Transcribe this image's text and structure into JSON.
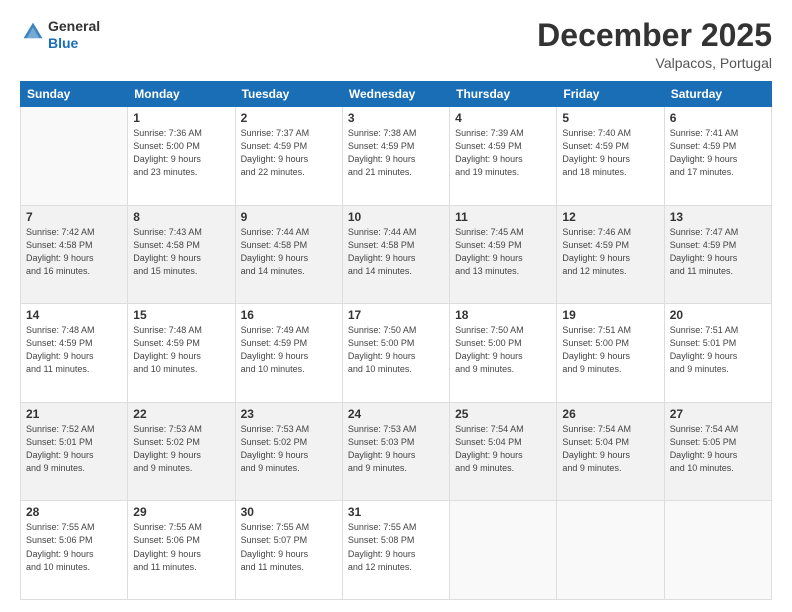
{
  "header": {
    "logo_line1": "General",
    "logo_line2": "Blue",
    "month": "December 2025",
    "location": "Valpacos, Portugal"
  },
  "weekdays": [
    "Sunday",
    "Monday",
    "Tuesday",
    "Wednesday",
    "Thursday",
    "Friday",
    "Saturday"
  ],
  "weeks": [
    [
      {
        "day": "",
        "info": ""
      },
      {
        "day": "1",
        "info": "Sunrise: 7:36 AM\nSunset: 5:00 PM\nDaylight: 9 hours\nand 23 minutes."
      },
      {
        "day": "2",
        "info": "Sunrise: 7:37 AM\nSunset: 4:59 PM\nDaylight: 9 hours\nand 22 minutes."
      },
      {
        "day": "3",
        "info": "Sunrise: 7:38 AM\nSunset: 4:59 PM\nDaylight: 9 hours\nand 21 minutes."
      },
      {
        "day": "4",
        "info": "Sunrise: 7:39 AM\nSunset: 4:59 PM\nDaylight: 9 hours\nand 19 minutes."
      },
      {
        "day": "5",
        "info": "Sunrise: 7:40 AM\nSunset: 4:59 PM\nDaylight: 9 hours\nand 18 minutes."
      },
      {
        "day": "6",
        "info": "Sunrise: 7:41 AM\nSunset: 4:59 PM\nDaylight: 9 hours\nand 17 minutes."
      }
    ],
    [
      {
        "day": "7",
        "info": "Sunrise: 7:42 AM\nSunset: 4:58 PM\nDaylight: 9 hours\nand 16 minutes."
      },
      {
        "day": "8",
        "info": "Sunrise: 7:43 AM\nSunset: 4:58 PM\nDaylight: 9 hours\nand 15 minutes."
      },
      {
        "day": "9",
        "info": "Sunrise: 7:44 AM\nSunset: 4:58 PM\nDaylight: 9 hours\nand 14 minutes."
      },
      {
        "day": "10",
        "info": "Sunrise: 7:44 AM\nSunset: 4:58 PM\nDaylight: 9 hours\nand 14 minutes."
      },
      {
        "day": "11",
        "info": "Sunrise: 7:45 AM\nSunset: 4:59 PM\nDaylight: 9 hours\nand 13 minutes."
      },
      {
        "day": "12",
        "info": "Sunrise: 7:46 AM\nSunset: 4:59 PM\nDaylight: 9 hours\nand 12 minutes."
      },
      {
        "day": "13",
        "info": "Sunrise: 7:47 AM\nSunset: 4:59 PM\nDaylight: 9 hours\nand 11 minutes."
      }
    ],
    [
      {
        "day": "14",
        "info": "Sunrise: 7:48 AM\nSunset: 4:59 PM\nDaylight: 9 hours\nand 11 minutes."
      },
      {
        "day": "15",
        "info": "Sunrise: 7:48 AM\nSunset: 4:59 PM\nDaylight: 9 hours\nand 10 minutes."
      },
      {
        "day": "16",
        "info": "Sunrise: 7:49 AM\nSunset: 4:59 PM\nDaylight: 9 hours\nand 10 minutes."
      },
      {
        "day": "17",
        "info": "Sunrise: 7:50 AM\nSunset: 5:00 PM\nDaylight: 9 hours\nand 10 minutes."
      },
      {
        "day": "18",
        "info": "Sunrise: 7:50 AM\nSunset: 5:00 PM\nDaylight: 9 hours\nand 9 minutes."
      },
      {
        "day": "19",
        "info": "Sunrise: 7:51 AM\nSunset: 5:00 PM\nDaylight: 9 hours\nand 9 minutes."
      },
      {
        "day": "20",
        "info": "Sunrise: 7:51 AM\nSunset: 5:01 PM\nDaylight: 9 hours\nand 9 minutes."
      }
    ],
    [
      {
        "day": "21",
        "info": "Sunrise: 7:52 AM\nSunset: 5:01 PM\nDaylight: 9 hours\nand 9 minutes."
      },
      {
        "day": "22",
        "info": "Sunrise: 7:53 AM\nSunset: 5:02 PM\nDaylight: 9 hours\nand 9 minutes."
      },
      {
        "day": "23",
        "info": "Sunrise: 7:53 AM\nSunset: 5:02 PM\nDaylight: 9 hours\nand 9 minutes."
      },
      {
        "day": "24",
        "info": "Sunrise: 7:53 AM\nSunset: 5:03 PM\nDaylight: 9 hours\nand 9 minutes."
      },
      {
        "day": "25",
        "info": "Sunrise: 7:54 AM\nSunset: 5:04 PM\nDaylight: 9 hours\nand 9 minutes."
      },
      {
        "day": "26",
        "info": "Sunrise: 7:54 AM\nSunset: 5:04 PM\nDaylight: 9 hours\nand 9 minutes."
      },
      {
        "day": "27",
        "info": "Sunrise: 7:54 AM\nSunset: 5:05 PM\nDaylight: 9 hours\nand 10 minutes."
      }
    ],
    [
      {
        "day": "28",
        "info": "Sunrise: 7:55 AM\nSunset: 5:06 PM\nDaylight: 9 hours\nand 10 minutes."
      },
      {
        "day": "29",
        "info": "Sunrise: 7:55 AM\nSunset: 5:06 PM\nDaylight: 9 hours\nand 11 minutes."
      },
      {
        "day": "30",
        "info": "Sunrise: 7:55 AM\nSunset: 5:07 PM\nDaylight: 9 hours\nand 11 minutes."
      },
      {
        "day": "31",
        "info": "Sunrise: 7:55 AM\nSunset: 5:08 PM\nDaylight: 9 hours\nand 12 minutes."
      },
      {
        "day": "",
        "info": ""
      },
      {
        "day": "",
        "info": ""
      },
      {
        "day": "",
        "info": ""
      }
    ]
  ]
}
